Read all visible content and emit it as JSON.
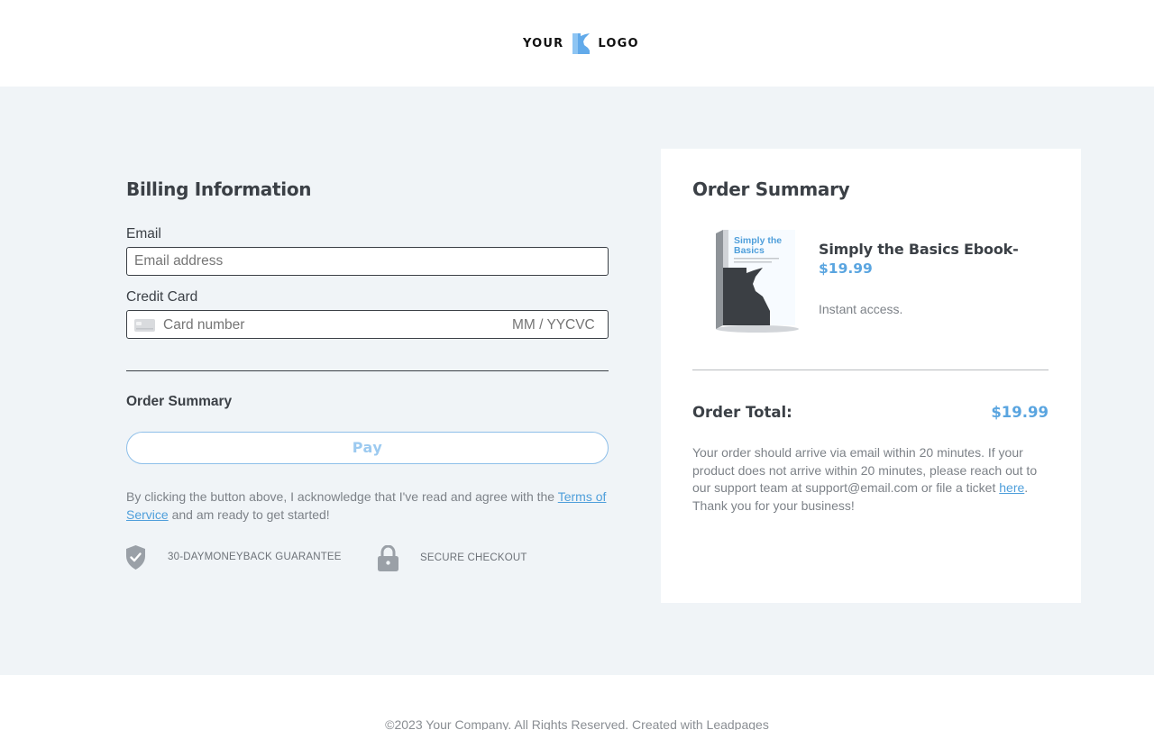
{
  "header": {
    "logo_left": "YOUR",
    "logo_right": "LOGO",
    "logo_icon": "state-map-icon",
    "logo_color": "#62aaea"
  },
  "billing": {
    "title": "Billing Information",
    "email_label": "Email",
    "email_placeholder": "Email address",
    "email_value": "",
    "card_label": "Credit Card",
    "card_icon": "credit-card-icon",
    "card_number_placeholder": "Card number",
    "card_expiry_placeholder": "MM / YY",
    "card_cvc_placeholder": "CVC",
    "order_summary_label": "Order Summary",
    "pay_label": "Pay",
    "legal_prefix": "By clicking the button above, I acknowledge that I've read and agree with the ",
    "terms_link": "Terms of Service",
    "legal_suffix": " and am ready to get started!",
    "trust": [
      {
        "icon": "shield-check-icon",
        "text": "30-DAYMONEYBACK GUARANTEE"
      },
      {
        "icon": "lock-icon",
        "text": "SECURE CHECKOUT"
      }
    ]
  },
  "summary": {
    "title": "Order Summary",
    "product": {
      "cover_title": "Simply the Basics",
      "name": "Simply the Basics Ebook-",
      "price": "$19.99",
      "description": "Instant access."
    },
    "total_label": "Order Total:",
    "total_value": "$19.99",
    "note_text": "Your order should arrive via email within 20 minutes. If your product does not arrive within 20 minutes, please reach out to our support team at support@email.com or file a ticket ",
    "note_link": "here",
    "note_suffix": ".",
    "note_thanks": "Thank you for your business!"
  },
  "footer": {
    "copyright": "©2023 Your Company. All Rights Reserved. Created with Leadpages"
  },
  "colors": {
    "accent": "#5aa5e0",
    "link": "#4f9fdb",
    "background": "#f0f4f7"
  }
}
